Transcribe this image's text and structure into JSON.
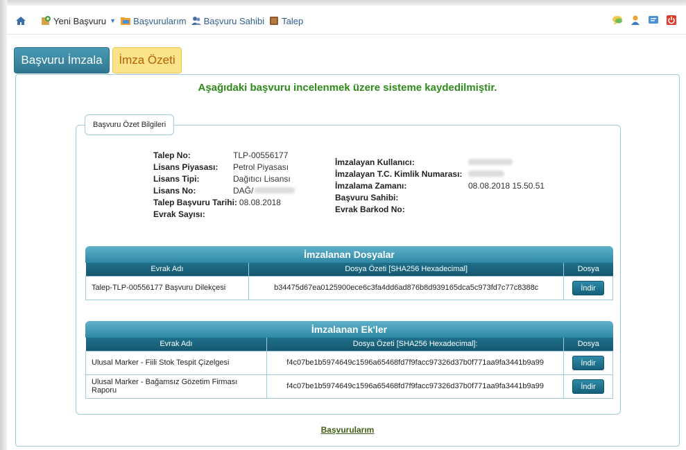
{
  "nav": {
    "items": [
      {
        "label": "Yeni Başvuru",
        "icon": "new-application-icon"
      },
      {
        "label": "Başvurularım",
        "icon": "my-applications-icon"
      },
      {
        "label": "Başvuru Sahibi",
        "icon": "applicant-icon"
      },
      {
        "label": "Talep",
        "icon": "request-icon"
      }
    ],
    "right_icons": [
      "chat-icon",
      "user-icon",
      "help-icon",
      "power-icon"
    ]
  },
  "tabs": {
    "sign": "Başvuru İmzala",
    "summary": "İmza Özeti"
  },
  "headline": "Aşağıdaki başvuru incelenmek üzere sisteme kaydedilmiştir.",
  "summary": {
    "legend": "Başvuru Özet Bilgileri",
    "left": [
      {
        "k": "Talep No:",
        "v": "TLP-00556177"
      },
      {
        "k": "Lisans Piyasası:",
        "v": "Petrol Piyasası"
      },
      {
        "k": "Lisans Tipi:",
        "v": "Dağıtıcı Lisansı"
      },
      {
        "k": "Lisans No:",
        "v": "DAĞ/"
      },
      {
        "k": "Talep Başvuru Tarihi:",
        "v": "08.08.2018"
      },
      {
        "k": "Evrak Sayısı:",
        "v": ""
      }
    ],
    "right": [
      {
        "k": "İmzalayan Kullanıcı:",
        "v": ""
      },
      {
        "k": "İmzalayan T.C. Kimlik Numarası:",
        "v": ""
      },
      {
        "k": "İmzalama Zamanı:",
        "v": "08.08.2018 15.50.51"
      },
      {
        "k": "Başvuru Sahibi:",
        "v": ""
      },
      {
        "k": "Evrak Barkod No:",
        "v": ""
      }
    ]
  },
  "files": {
    "title": "İmzalanan Dosyalar",
    "headers": [
      "Evrak Adı",
      "Dosya Özeti [SHA256 Hexadecimal]",
      "Dosya"
    ],
    "rows": [
      {
        "name": "Talep-TLP-00556177 Başvuru Dilekçesi",
        "hash": "b34475d67ea0125900ece6c3fa4dd6ad876b8d939165dca5c973fd7c77c8388c",
        "button": "İndir"
      }
    ]
  },
  "attachments": {
    "title": "İmzalanan Ek'ler",
    "headers": [
      "Evrak Adı",
      "Dosya Özeti [SHA256 Hexadecimal]:",
      "Dosya"
    ],
    "rows": [
      {
        "name": "Ulusal Marker - Fiili Stok Tespit Çizelgesi",
        "hash": "f4c07be1b5974649c1596a65468fd7f9facc97326d37b0f771aa9fa3441b9a99",
        "button": "İndir"
      },
      {
        "name": "Ulusal Marker - Bağamsız Gözetim Firması Raporu",
        "hash": "f4c07be1b5974649c1596a65468fd7f9facc97326d37b0f771aa9fa3441b9a99",
        "button": "İndir"
      }
    ]
  },
  "bottom_link": "Başvurularım",
  "colors": {
    "accent": "#2e88a6",
    "headline": "#2e8b1a",
    "tab_summary_bg": "#fbe38a"
  }
}
